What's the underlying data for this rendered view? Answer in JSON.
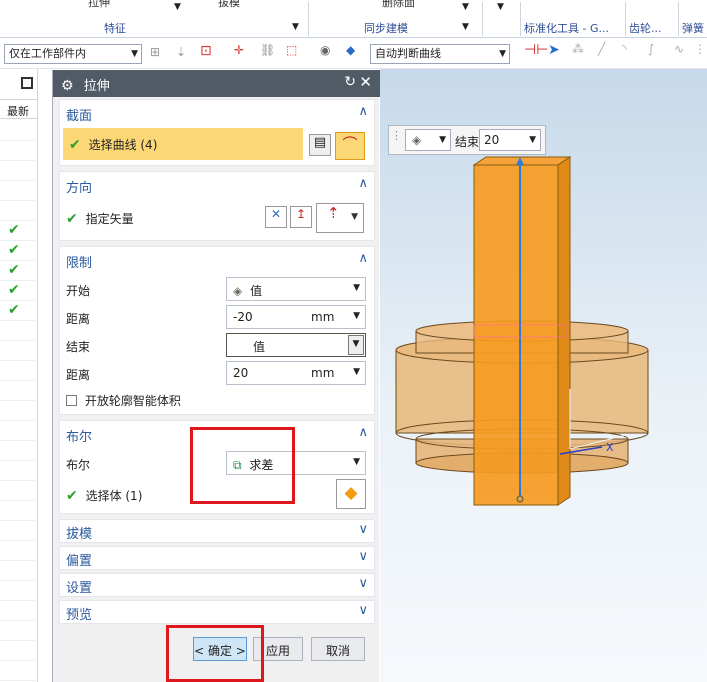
{
  "ribbon": {
    "groups": [
      {
        "label": "特征",
        "top": "拉伸"
      },
      {
        "label": "同步建模",
        "top": "删除面"
      },
      {
        "label": "标准化工具 - G...",
        "top": ""
      },
      {
        "label": "齿轮...",
        "top": ""
      },
      {
        "label": "弹簧",
        "top": ""
      }
    ],
    "top_items": [
      "拉伸",
      "拔模",
      "删除面"
    ]
  },
  "toolbar": {
    "filter_value": "仅在工作部件内",
    "curve_rule_value": "自动判断曲线"
  },
  "left_panel": {
    "header": "最新",
    "check_rows": 5
  },
  "dialog": {
    "title": "拉伸",
    "sections": {
      "section": {
        "title": "截面",
        "select_curve": "选择曲线 (4)"
      },
      "direction": {
        "title": "方向",
        "specify_vector": "指定矢量"
      },
      "limits": {
        "title": "限制",
        "start_label": "开始",
        "start_value": "值",
        "distance1_label": "距离",
        "distance1_value": "-20",
        "distance1_unit": "mm",
        "end_label": "结束",
        "end_value": "值",
        "distance2_label": "距离",
        "distance2_value": "20",
        "distance2_unit": "mm",
        "open_profile_label": "开放轮廓智能体积"
      },
      "boolean": {
        "title": "布尔",
        "bool_label": "布尔",
        "bool_value": "求差",
        "select_body": "选择体 (1)"
      },
      "draft": {
        "title": "拔模"
      },
      "offset": {
        "title": "偏置"
      },
      "settings": {
        "title": "设置"
      },
      "preview": {
        "title": "预览"
      }
    },
    "buttons": {
      "ok": "< 确定 >",
      "apply": "应用",
      "cancel": "取消"
    }
  },
  "viewport": {
    "mini_toolbar": {
      "end_label": "结束",
      "end_value": "20"
    },
    "axis_label": "X"
  }
}
